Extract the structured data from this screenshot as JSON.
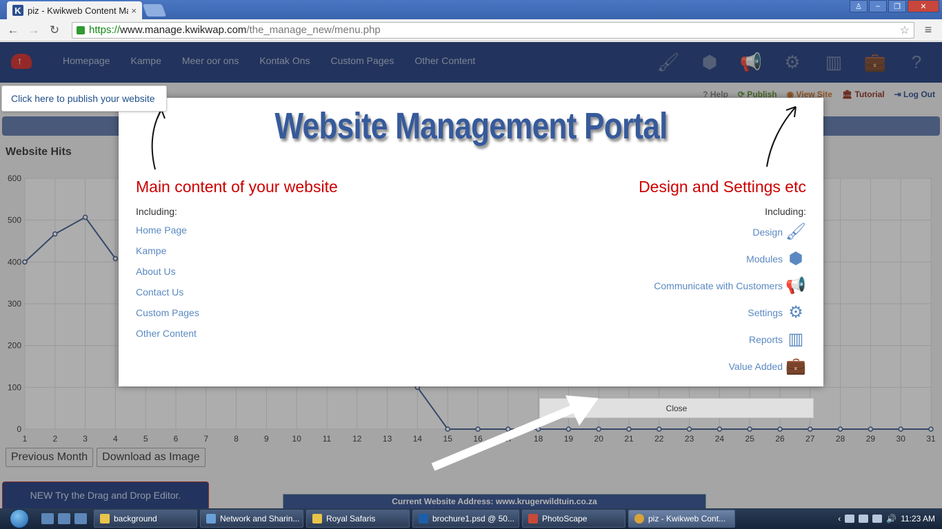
{
  "browser": {
    "tab_title": "piz - Kwikweb Content Ma",
    "tab_close": "×",
    "url_scheme": "https://",
    "url_host": "www.manage.kwikwap.com",
    "url_path": "/the_manage_new/menu.php"
  },
  "nav": {
    "links": [
      "Homepage",
      "Kampe",
      "Meer oor ons",
      "Kontak Ons",
      "Custom Pages",
      "Other Content"
    ],
    "icons": [
      "paintbrush-icon",
      "cubes-icon",
      "megaphone-icon",
      "gears-icon",
      "bar-chart-icon",
      "briefcase-icon",
      "question-icon"
    ]
  },
  "publish_tip": "Click here to publish your website",
  "util_links": {
    "help": "Help",
    "publish": "Publish",
    "view_site": "View Site",
    "tutorial": "Tutorial",
    "logout": "Log Out"
  },
  "hits": {
    "title": "Website Hits",
    "prev_month": "Previous Month",
    "download": "Download as Image"
  },
  "chart_data": {
    "type": "line",
    "title": "Website Hits",
    "x": [
      1,
      2,
      3,
      4,
      5,
      6,
      7,
      8,
      9,
      10,
      11,
      12,
      13,
      14,
      15,
      16,
      17,
      18,
      19,
      20,
      21,
      22,
      23,
      24,
      25,
      26,
      27,
      28,
      29,
      30,
      31
    ],
    "values": [
      400,
      467,
      507,
      408,
      null,
      null,
      null,
      null,
      null,
      null,
      null,
      null,
      null,
      100,
      0,
      0,
      0,
      0,
      0,
      0,
      0,
      0,
      0,
      0,
      0,
      0,
      0,
      0,
      0,
      0,
      0
    ],
    "y_ticks": [
      0,
      100,
      200,
      300,
      400,
      500,
      600
    ],
    "ylim": [
      0,
      600
    ],
    "grid": true,
    "color": "#3c5a8a"
  },
  "modal": {
    "title": "Website Management Portal",
    "left_heading": "Main content of your website",
    "left_including": "Including:",
    "left_items": [
      "Home Page",
      "Kampe",
      "About Us",
      "Contact Us",
      "Custom Pages",
      "Other Content"
    ],
    "right_heading": "Design and Settings etc",
    "right_including": "Including:",
    "right_items": [
      {
        "label": "Design",
        "icon": "paintbrush-icon"
      },
      {
        "label": "Modules",
        "icon": "cubes-icon"
      },
      {
        "label": "Communicate with Customers",
        "icon": "megaphone-icon"
      },
      {
        "label": "Settings",
        "icon": "gears-icon"
      },
      {
        "label": "Reports",
        "icon": "bar-chart-icon"
      },
      {
        "label": "Value Added",
        "icon": "briefcase-icon"
      }
    ],
    "close": "Close"
  },
  "footer": {
    "dnd_tip": "NEW Try the Drag and Drop Editor.",
    "address": "Current Website Address: www.krugerwildtuin.co.za"
  },
  "taskbar": {
    "items": [
      "background",
      "Network and Sharin...",
      "Royal Safaris",
      "brochure1.psd @ 50...",
      "PhotoScape",
      "piz - Kwikweb Cont..."
    ],
    "clock": "11:23 AM"
  }
}
